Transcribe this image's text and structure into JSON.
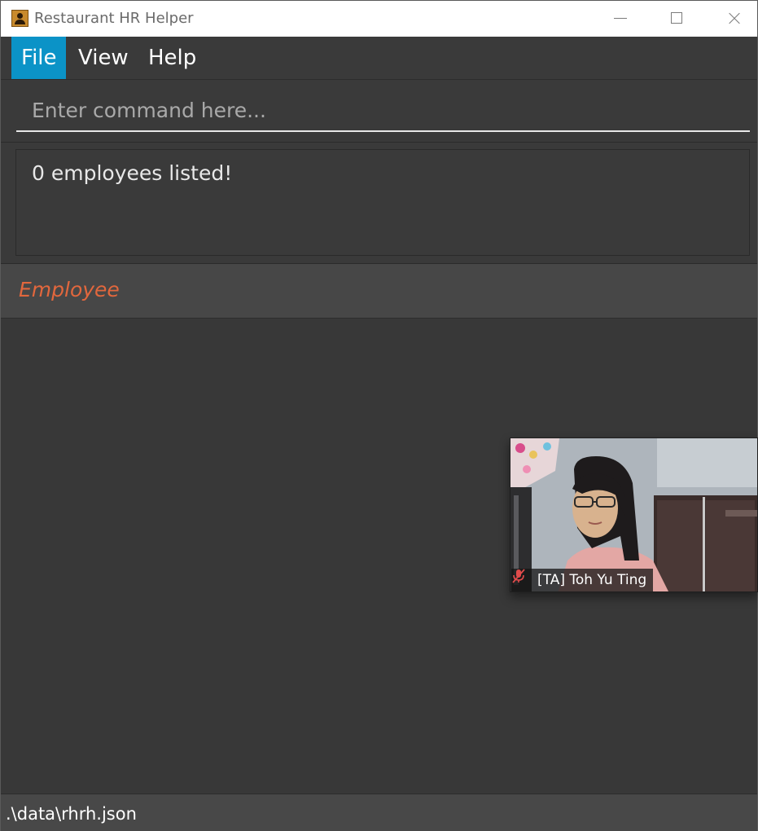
{
  "window": {
    "title": "Restaurant HR Helper"
  },
  "menu": {
    "items": [
      {
        "label": "File"
      },
      {
        "label": "View"
      },
      {
        "label": "Help"
      }
    ]
  },
  "command": {
    "placeholder": "Enter command here...",
    "value": ""
  },
  "result": {
    "message": "0 employees listed!"
  },
  "employee_panel": {
    "title": "Employee",
    "items": []
  },
  "status": {
    "file_path": ".\\data\\rhrh.json"
  },
  "video": {
    "participant_name": "[TA] Toh Yu Ting",
    "mic_icon": "mic-off-icon"
  },
  "colors": {
    "accent": "#0b93c7",
    "employee_title": "#e2673d",
    "background": "#383838"
  }
}
